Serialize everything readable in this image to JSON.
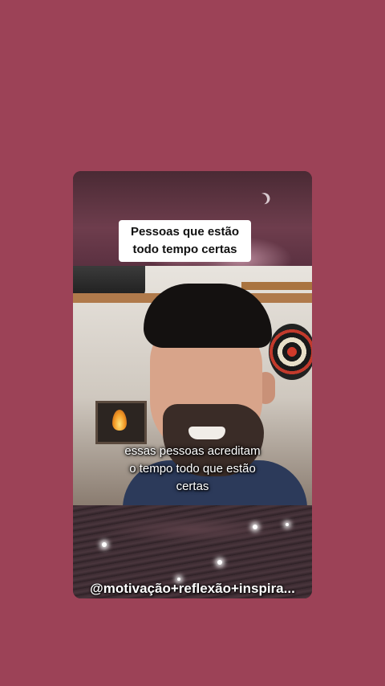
{
  "post": {
    "title_line1": "Pessoas que estão",
    "title_line2": "todo tempo certas",
    "caption_line1": "essas pessoas acreditam",
    "caption_line2": "o tempo todo que estão",
    "caption_line3": "certas",
    "handle": "@motivação+reflexão+inspira..."
  },
  "colors": {
    "background": "#9c4257",
    "title_box": "#ffffff"
  },
  "icons": {
    "moon": "crescent-moon",
    "flame": "fireplace-flame"
  }
}
